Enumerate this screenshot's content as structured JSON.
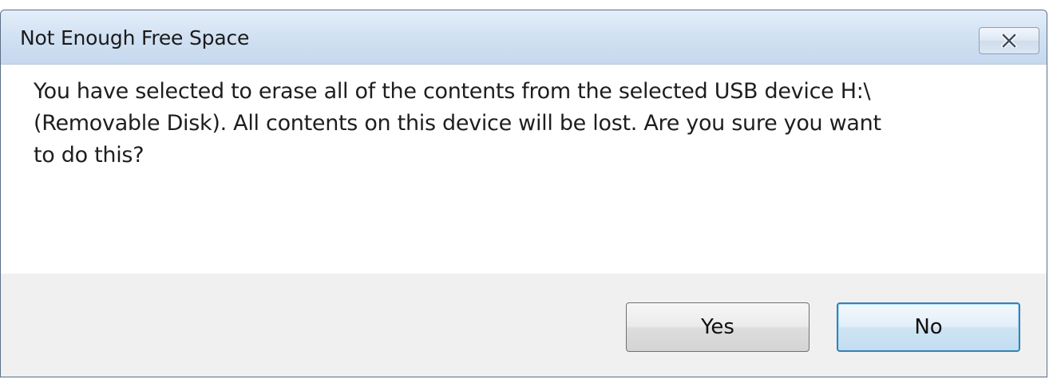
{
  "dialog": {
    "title": "Not Enough Free Space",
    "close_icon": "close-x-icon",
    "message": "You have selected to erase all of the contents from the selected USB device H:\\\n(Removable Disk).  All contents on this device will be lost.  Are you sure you want\nto do this?",
    "buttons": {
      "yes_label": "Yes",
      "no_label": "No",
      "default": "No"
    }
  }
}
